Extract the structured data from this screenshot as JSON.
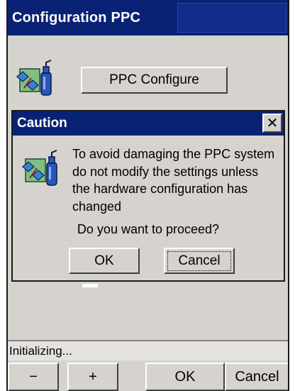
{
  "window": {
    "title": "Configuration PPC"
  },
  "main": {
    "configure_button": "PPC Configure",
    "icon": "ppc-config-icon"
  },
  "dialog": {
    "title": "Caution",
    "close_label": "✕",
    "icon": "ppc-config-icon",
    "message_lines": [
      "To avoid damaging the PPC system",
      "do not modify the settings unless",
      "the hardware configuration has",
      "changed"
    ],
    "question": "Do you want to proceed?",
    "ok_label": "OK",
    "cancel_label": "Cancel"
  },
  "status": {
    "text": "Initializing..."
  },
  "toolbar": {
    "minus_label": "−",
    "plus_label": "+",
    "ok_label": "OK",
    "cancel_label": "Cancel"
  },
  "colors": {
    "title_bar": "#0a2276",
    "face": "#d6d3ce"
  }
}
